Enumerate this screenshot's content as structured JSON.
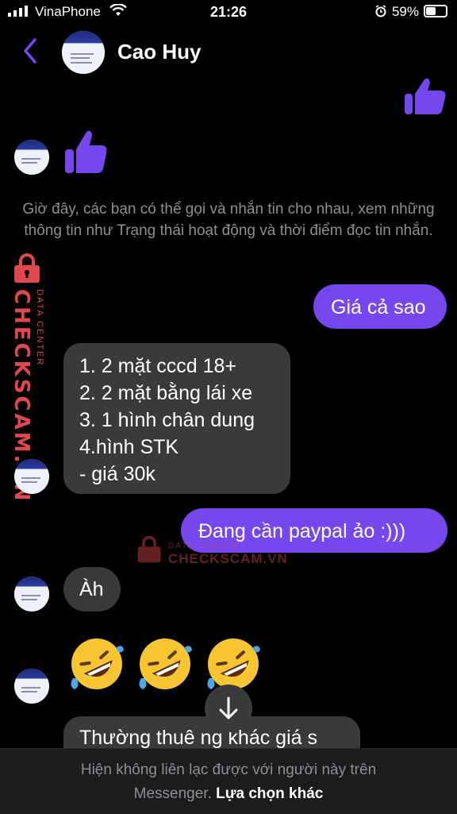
{
  "status_bar": {
    "carrier": "VinaPhone",
    "time": "21:26",
    "battery": "59%",
    "battery_level": 0.59
  },
  "header": {
    "contact_name": "Cao Huy",
    "back_icon": "chevron-left-icon",
    "accent_color": "#7646ef"
  },
  "messages": {
    "notice": "Giờ đây, các bạn có thể gọi và nhắn tin cho nhau, xem những thông tin như Trạng thái hoạt động và thời điểm đọc tin nhắn.",
    "out_price": "Giá cả sao",
    "in_list": [
      "1. 2 mặt cccd 18+",
      "2. 2 mặt bằng lái xe",
      "3. 1 hình chân dung",
      "4.hình STK",
      "- giá 30k"
    ],
    "out_paypal": "Đang cần paypal ảo :)))",
    "in_ah": "Àh",
    "in_partial": "Thường thuê ng khác giá s",
    "emoji_count": 3
  },
  "watermark": {
    "brand": "CHECKSCAM.VN",
    "sub": "DATA CENTER"
  },
  "footer": {
    "line1": "Hiện không liên lạc được với người này trên",
    "line2_muted": "Messenger.",
    "line2_link": "Lựa chọn khác"
  }
}
